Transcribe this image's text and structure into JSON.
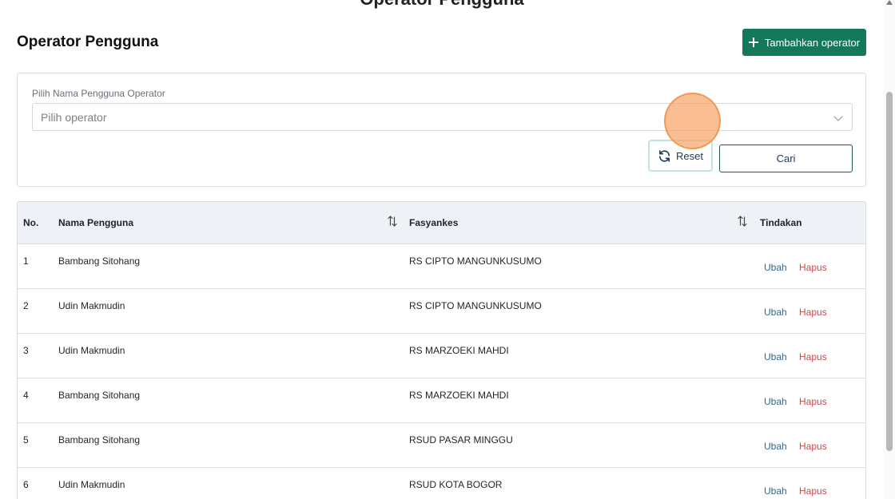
{
  "top_title": "Operator Pengguna",
  "header": {
    "title": "Operator Pengguna",
    "add_button_label": "Tambahkan operator"
  },
  "filter": {
    "label": "Pilih Nama Pengguna Operator",
    "select_placeholder": "Pilih operator",
    "reset_label": "Reset",
    "search_label": "Cari"
  },
  "table": {
    "columns": {
      "no": "No.",
      "name": "Nama Pengguna",
      "facility": "Fasyankes",
      "action": "Tindakan"
    },
    "action_edit": "Ubah",
    "action_delete": "Hapus",
    "rows": [
      {
        "no": "1",
        "name": "Bambang Sitohang",
        "facility": "RS CIPTO MANGUNKUSUMO"
      },
      {
        "no": "2",
        "name": "Udin Makmudin",
        "facility": "RS CIPTO MANGUNKUSUMO"
      },
      {
        "no": "3",
        "name": "Udin Makmudin",
        "facility": "RS MARZOEKI MAHDI"
      },
      {
        "no": "4",
        "name": "Bambang Sitohang",
        "facility": "RS MARZOEKI MAHDI"
      },
      {
        "no": "5",
        "name": "Bambang Sitohang",
        "facility": "RSUD PASAR MINGGU"
      },
      {
        "no": "6",
        "name": "Udin Makmudin",
        "facility": "RSUD KOTA BOGOR"
      }
    ]
  },
  "colors": {
    "primary": "#14785a",
    "link_edit": "#2f6a8f",
    "link_delete": "#d1464b",
    "table_header_bg": "#eef2f6"
  }
}
